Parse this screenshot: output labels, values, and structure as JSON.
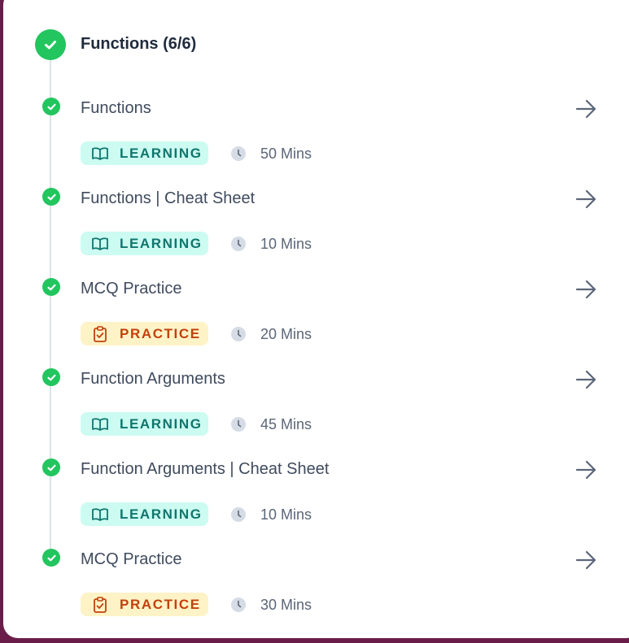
{
  "module": {
    "title": "Functions (6/6)",
    "status": "completed"
  },
  "colors": {
    "complete_green": "#22c55e",
    "learning_bg": "#ccfbf1",
    "learning_text": "#0f766e",
    "practice_bg": "#fef3c7",
    "practice_text": "#c2410c"
  },
  "items": [
    {
      "title": "Functions",
      "type": "LEARNING",
      "type_icon": "book-open-icon",
      "duration": "50 Mins"
    },
    {
      "title": "Functions | Cheat Sheet",
      "type": "LEARNING",
      "type_icon": "book-open-icon",
      "duration": "10 Mins"
    },
    {
      "title": "MCQ Practice",
      "type": "PRACTICE",
      "type_icon": "clipboard-check-icon",
      "duration": "20 Mins"
    },
    {
      "title": "Function Arguments",
      "type": "LEARNING",
      "type_icon": "book-open-icon",
      "duration": "45 Mins"
    },
    {
      "title": "Function Arguments | Cheat Sheet",
      "type": "LEARNING",
      "type_icon": "book-open-icon",
      "duration": "10 Mins"
    },
    {
      "title": "MCQ Practice",
      "type": "PRACTICE",
      "type_icon": "clipboard-check-icon",
      "duration": "30 Mins"
    }
  ]
}
